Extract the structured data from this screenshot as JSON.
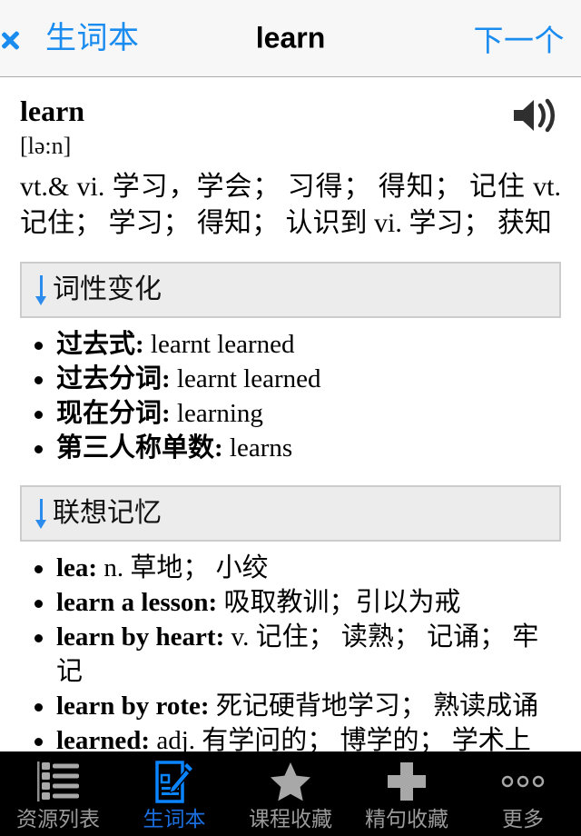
{
  "navbar": {
    "back_label": "生词本",
    "back_icon": "chevron-left-icon",
    "title": "learn",
    "next_label": "下一个"
  },
  "entry": {
    "headword": "learn",
    "speaker_icon": "speaker-icon",
    "phonetic": "[lə:n]",
    "senses": "vt.& vi. 学习，学会； 习得； 得知； 记住 vt. 记住； 学习； 得知； 认识到 vi. 学习； 获知"
  },
  "sections": [
    {
      "arrow_icon": "arrow-down-icon",
      "title": "词性变化",
      "items": [
        {
          "term": "过去式:",
          "def": " learnt learned"
        },
        {
          "term": "过去分词:",
          "def": " learnt learned"
        },
        {
          "term": "现在分词:",
          "def": " learning"
        },
        {
          "term": "第三人称单数:",
          "def": " learns"
        }
      ]
    },
    {
      "arrow_icon": "arrow-down-icon",
      "title": "联想记忆",
      "items": [
        {
          "term": "lea:",
          "def": " n. 草地； 小绞"
        },
        {
          "term": "learn a lesson:",
          "def": " 吸取教训；引以为戒"
        },
        {
          "term": "learn by heart:",
          "def": " v. 记住； 读熟； 记诵； 牢记"
        },
        {
          "term": "learn by rote:",
          "def": " 死记硬背地学习； 熟读成诵"
        },
        {
          "term": "learned:",
          "def": " adj. 有学问的； 博学的； 学术上"
        }
      ]
    }
  ],
  "tabbar": {
    "active_color": "#1b6fe0",
    "inactive_color": "#9a9a9a",
    "tabs": [
      {
        "label": "资源列表",
        "icon": "list-icon",
        "active": false
      },
      {
        "label": "生词本",
        "icon": "notebook-pencil-icon",
        "active": true
      },
      {
        "label": "课程收藏",
        "icon": "star-icon",
        "active": false
      },
      {
        "label": "精句收藏",
        "icon": "plus-icon",
        "active": false
      },
      {
        "label": "更多",
        "icon": "ellipsis-icon",
        "active": false
      }
    ]
  }
}
